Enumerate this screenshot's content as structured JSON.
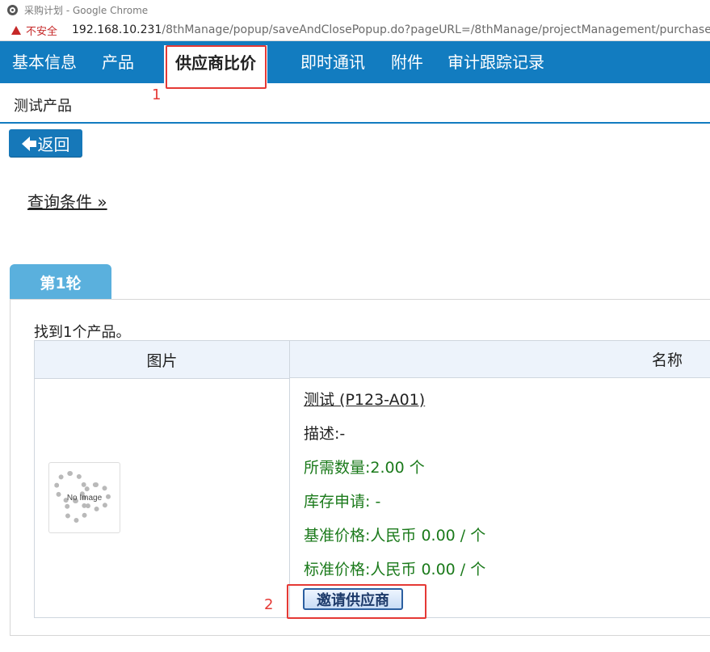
{
  "browser": {
    "window_title": "采购计划 - Google Chrome",
    "security_label": "不安全",
    "url_host": "192.168.10.231",
    "url_path": "/8thManage/popup/saveAndClosePopup.do?pageURL=/8thManage/projectManagement/purchasePla"
  },
  "tabs": [
    {
      "label": "基本信息"
    },
    {
      "label": "产品"
    },
    {
      "label": "供应商比价"
    },
    {
      "label": "即时通讯"
    },
    {
      "label": "附件"
    },
    {
      "label": "审计跟踪记录"
    }
  ],
  "product_title": "测试产品",
  "back_button": "返回",
  "query_link": "查询条件 »",
  "round_tab": "第1轮",
  "found_text": "找到1个产品。",
  "table": {
    "col_image": "图片",
    "col_name": "名称",
    "no_image_label": "No Image",
    "product_link": "测试 (P123-A01)",
    "description": "描述:-",
    "required_qty": "所需数量:2.00 个",
    "stock_request": "库存申请: -",
    "base_price": "基准价格:人民币 0.00 / 个",
    "standard_price": "标准价格:人民币 0.00 / 个",
    "invite_button": "邀请供应商"
  },
  "annotations": [
    "1",
    "2"
  ],
  "colors": {
    "accent": "#127cc0",
    "annotation": "#e53935",
    "green_text": "#1b7a1b"
  }
}
